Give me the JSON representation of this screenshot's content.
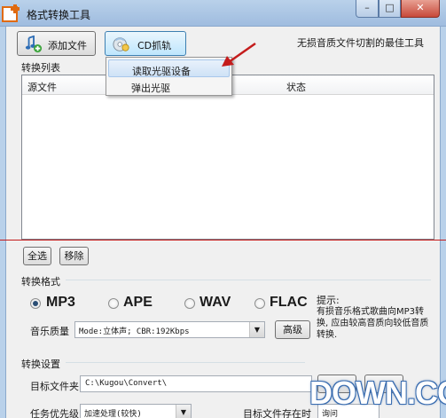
{
  "window": {
    "title": "格式转换工具",
    "controls": {
      "minimize": "–",
      "maximize": "□",
      "close": "✕"
    }
  },
  "toolbar": {
    "add_file_label": "添加文件",
    "cd_rip_label": "CD抓轨",
    "slogan": "无损音质文件切割的最佳工具"
  },
  "cd_menu": {
    "items": [
      {
        "label": "读取光驱设备",
        "highlighted": true
      },
      {
        "label": "弹出光驱",
        "highlighted": false
      }
    ]
  },
  "convert_list": {
    "label": "转换列表",
    "columns": [
      "源文件",
      "状态"
    ],
    "rows": []
  },
  "list_actions": {
    "select_all": "全选",
    "remove": "移除"
  },
  "format_section": {
    "label": "转换格式",
    "formats": [
      {
        "label": "MP3",
        "selected": true
      },
      {
        "label": "APE",
        "selected": false
      },
      {
        "label": "WAV",
        "selected": false
      },
      {
        "label": "FLAC",
        "selected": false
      }
    ],
    "quality_label": "音乐质量",
    "quality_value": "Mode:立体声; CBR:192Kbps",
    "advanced_button": "高级",
    "hint_title": "提示:",
    "hint_text": "有损音乐格式歌曲向MP3转换, 应由较高音质向较低音质转换."
  },
  "settings_section": {
    "label": "转换设置",
    "target_folder_label": "目标文件夹",
    "target_folder_value": "C:\\Kugou\\Convert\\",
    "priority_label": "任务优先级",
    "priority_value": "加速处理(较快)",
    "exists_label": "目标文件存在时",
    "exists_value": "询问"
  },
  "watermark": {
    "text": "DOWN.CC"
  },
  "colors": {
    "accent_red": "#c41c1c",
    "title_bar": "#b9d1ea",
    "watermark_blue": "#3a6db0"
  }
}
